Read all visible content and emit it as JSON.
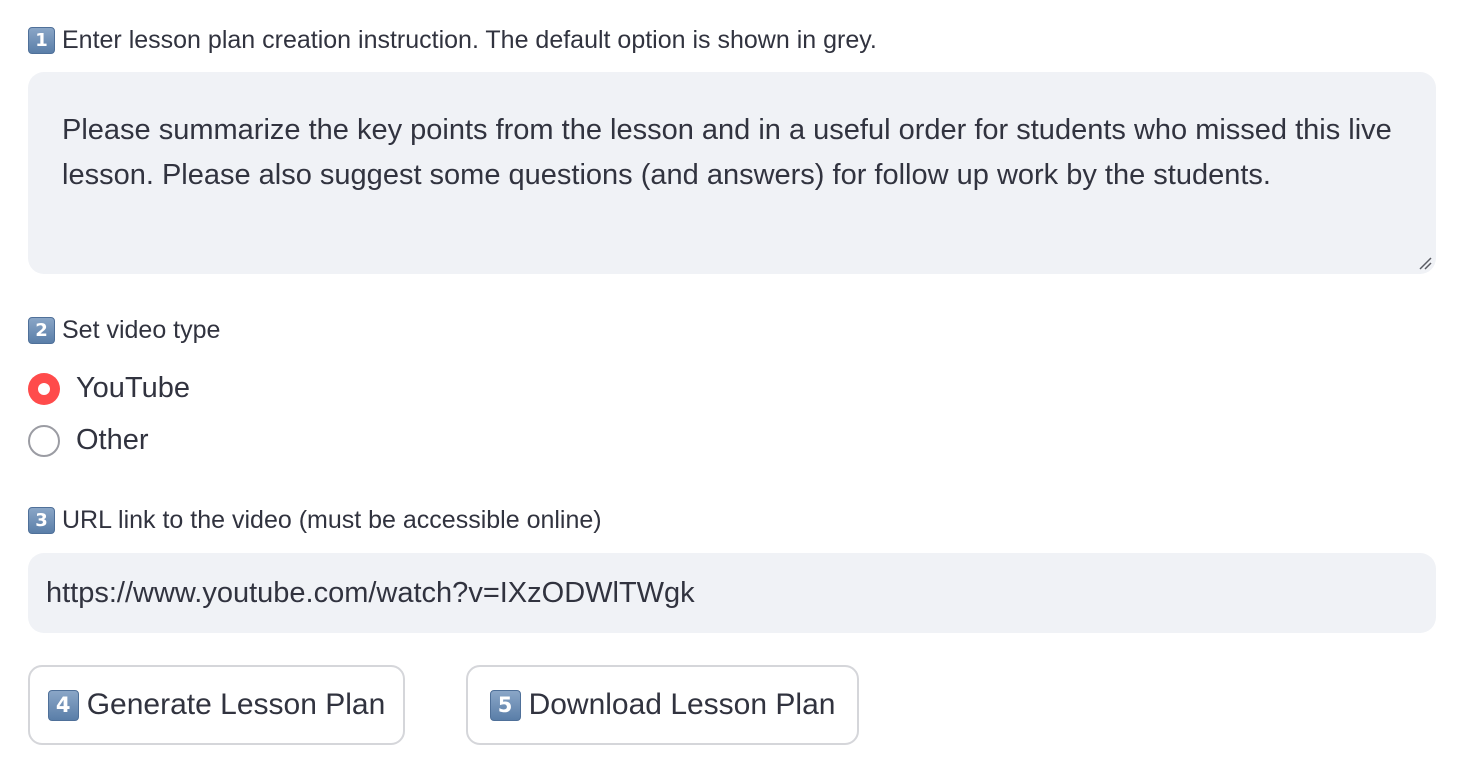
{
  "instruction": {
    "badge": "1",
    "label": "Enter lesson plan creation instruction. The default option is shown in grey.",
    "value": "Please summarize the key points from the lesson and in a useful order for students who missed this live lesson. Please also suggest some questions (and answers) for follow up work by the students."
  },
  "video_type": {
    "badge": "2",
    "label": "Set video type",
    "options": [
      {
        "label": "YouTube",
        "selected": true
      },
      {
        "label": "Other",
        "selected": false
      }
    ]
  },
  "video_url": {
    "badge": "3",
    "label": "URL link to the video (must be accessible online)",
    "value": "https://www.youtube.com/watch?v=IXzODWlTWgk"
  },
  "buttons": {
    "generate": {
      "badge": "4",
      "label": "Generate Lesson Plan"
    },
    "download": {
      "badge": "5",
      "label": "Download Lesson Plan"
    }
  },
  "colors": {
    "accent": "#ff4b4b",
    "input_bg": "#f0f2f6",
    "text": "#31333f",
    "badge": "#6b8db5"
  },
  "icons": {
    "resize": "resize-handle-icon",
    "radio_checked": "radio-checked-icon",
    "radio_unchecked": "radio-unchecked-icon"
  }
}
